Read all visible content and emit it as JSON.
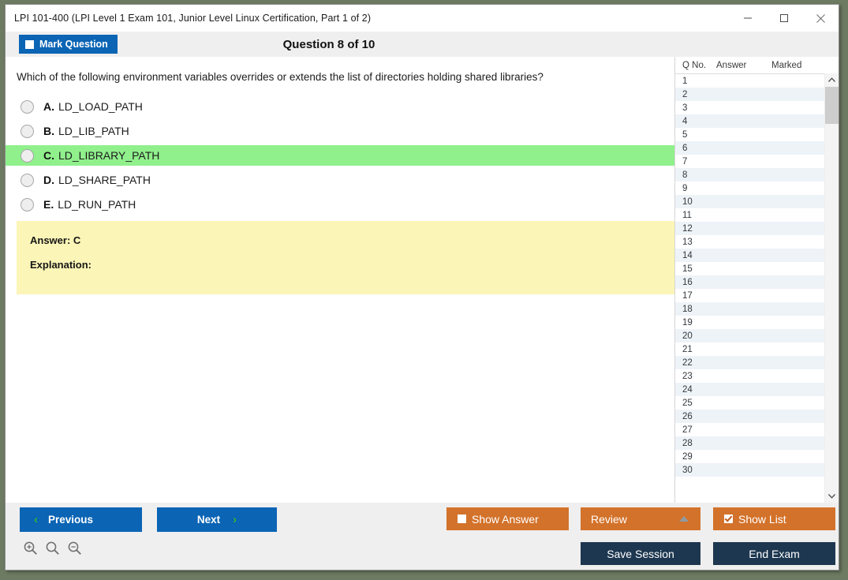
{
  "window": {
    "title": "LPI 101-400 (LPI Level 1 Exam 101, Junior Level Linux Certification, Part 1 of 2)",
    "minimize_label": "—",
    "maximize_label": "□",
    "close_label": "✕"
  },
  "header": {
    "mark_question_label": "Mark Question",
    "mark_question_checked": false,
    "question_counter": "Question 8 of 10"
  },
  "question": {
    "text": "Which of the following environment variables overrides or extends the list of directories holding shared libraries?",
    "options": [
      {
        "letter": "A.",
        "text": "LD_LOAD_PATH",
        "correct": false
      },
      {
        "letter": "B.",
        "text": "LD_LIB_PATH",
        "correct": false
      },
      {
        "letter": "C.",
        "text": "LD_LIBRARY_PATH",
        "correct": true
      },
      {
        "letter": "D.",
        "text": "LD_SHARE_PATH",
        "correct": false
      },
      {
        "letter": "E.",
        "text": "LD_RUN_PATH",
        "correct": false
      }
    ]
  },
  "answer_panel": {
    "answer_label": "Answer: C",
    "explanation_label": "Explanation:"
  },
  "question_list": {
    "columns": [
      "Q No.",
      "Answer",
      "Marked"
    ],
    "rows": [
      {
        "no": "1",
        "answer": "",
        "marked": ""
      },
      {
        "no": "2",
        "answer": "",
        "marked": ""
      },
      {
        "no": "3",
        "answer": "",
        "marked": ""
      },
      {
        "no": "4",
        "answer": "",
        "marked": ""
      },
      {
        "no": "5",
        "answer": "",
        "marked": ""
      },
      {
        "no": "6",
        "answer": "",
        "marked": ""
      },
      {
        "no": "7",
        "answer": "",
        "marked": ""
      },
      {
        "no": "8",
        "answer": "",
        "marked": ""
      },
      {
        "no": "9",
        "answer": "",
        "marked": ""
      },
      {
        "no": "10",
        "answer": "",
        "marked": ""
      },
      {
        "no": "11",
        "answer": "",
        "marked": ""
      },
      {
        "no": "12",
        "answer": "",
        "marked": ""
      },
      {
        "no": "13",
        "answer": "",
        "marked": ""
      },
      {
        "no": "14",
        "answer": "",
        "marked": ""
      },
      {
        "no": "15",
        "answer": "",
        "marked": ""
      },
      {
        "no": "16",
        "answer": "",
        "marked": ""
      },
      {
        "no": "17",
        "answer": "",
        "marked": ""
      },
      {
        "no": "18",
        "answer": "",
        "marked": ""
      },
      {
        "no": "19",
        "answer": "",
        "marked": ""
      },
      {
        "no": "20",
        "answer": "",
        "marked": ""
      },
      {
        "no": "21",
        "answer": "",
        "marked": ""
      },
      {
        "no": "22",
        "answer": "",
        "marked": ""
      },
      {
        "no": "23",
        "answer": "",
        "marked": ""
      },
      {
        "no": "24",
        "answer": "",
        "marked": ""
      },
      {
        "no": "25",
        "answer": "",
        "marked": ""
      },
      {
        "no": "26",
        "answer": "",
        "marked": ""
      },
      {
        "no": "27",
        "answer": "",
        "marked": ""
      },
      {
        "no": "28",
        "answer": "",
        "marked": ""
      },
      {
        "no": "29",
        "answer": "",
        "marked": ""
      },
      {
        "no": "30",
        "answer": "",
        "marked": ""
      }
    ],
    "scroll_up_label": "∧",
    "scroll_down_label": "∨"
  },
  "footer": {
    "previous_label": "Previous",
    "next_label": "Next",
    "previous_chevron": "‹",
    "next_chevron": "›",
    "show_answer_label": "Show Answer",
    "show_answer_checked": false,
    "review_label": "Review",
    "show_list_label": "Show List",
    "show_list_checked": true,
    "save_session_label": "Save Session",
    "end_exam_label": "End Exam"
  },
  "colors": {
    "accent_blue": "#0b64b4",
    "accent_orange": "#d3722a",
    "navy": "#1d3750",
    "correct_green": "#90F08C",
    "answer_yellow": "#FBF5B7",
    "chevron_green": "#30b830"
  }
}
